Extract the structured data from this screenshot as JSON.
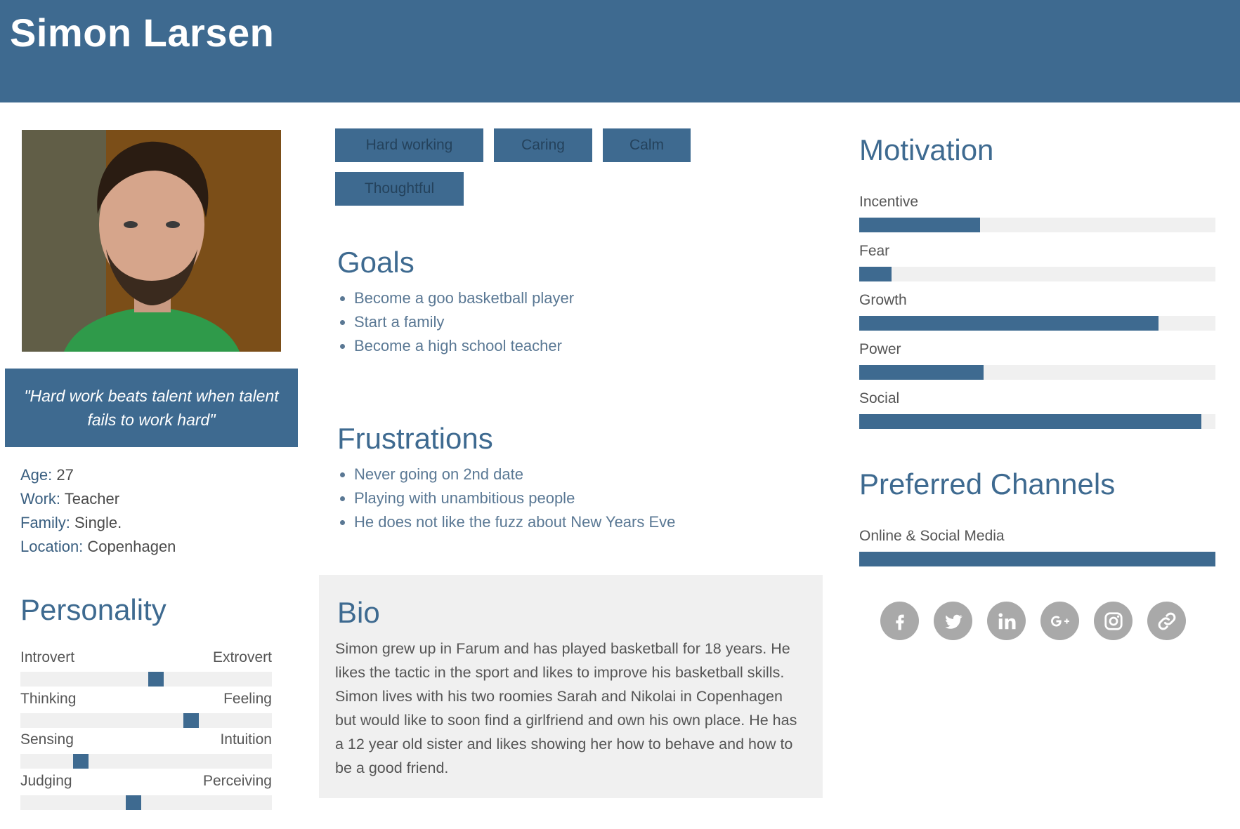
{
  "header": {
    "name": "Simon Larsen"
  },
  "quote": "\"Hard work beats talent when talent fails to work hard\"",
  "facts": [
    {
      "key": "Age:",
      "value": " 27"
    },
    {
      "key": "Work:",
      "value": " Teacher"
    },
    {
      "key": "Family:",
      "value": " Single."
    },
    {
      "key": "Location:",
      "value": " Copenhagen"
    }
  ],
  "personality": {
    "title": "Personality",
    "traits": [
      {
        "left": "Introvert",
        "right": "Extrovert",
        "value": 0.54
      },
      {
        "left": "Thinking",
        "right": "Feeling",
        "value": 0.68
      },
      {
        "left": "Sensing",
        "right": "Intuition",
        "value": 0.24
      },
      {
        "left": "Judging",
        "right": "Perceiving",
        "value": 0.45
      }
    ]
  },
  "tags": [
    "Hard working",
    "Caring",
    "Calm",
    "Thoughtful"
  ],
  "goals": {
    "title": "Goals",
    "items": [
      "Become a goo basketball player",
      "Start a family",
      "Become a high school teacher"
    ]
  },
  "frustrations": {
    "title": "Frustrations",
    "items": [
      "Never going on 2nd date",
      "Playing with unambitious people",
      "He does not like the fuzz about New Years Eve"
    ]
  },
  "bio": {
    "title": "Bio",
    "text": "Simon grew up in Farum and has played basketball for 18 years. He likes the tactic in the sport and likes to improve his basketball skills. Simon lives with his two roomies Sarah and Nikolai in Copenhagen but would like to soon find a girlfriend and own his own place. He has a 12 year old sister and likes showing her how to behave and how to be a good friend."
  },
  "motivation": {
    "title": "Motivation",
    "items": [
      {
        "label": "Incentive",
        "value": 0.34
      },
      {
        "label": "Fear",
        "value": 0.09
      },
      {
        "label": "Growth",
        "value": 0.84
      },
      {
        "label": "Power",
        "value": 0.35
      },
      {
        "label": "Social",
        "value": 0.96
      }
    ]
  },
  "channels": {
    "title": "Preferred Channels",
    "items": [
      {
        "label": "Online & Social Media",
        "value": 1.0
      }
    ],
    "icons": [
      "facebook-icon",
      "twitter-icon",
      "linkedin-icon",
      "google-plus-icon",
      "instagram-icon",
      "link-icon"
    ]
  },
  "colors": {
    "primary": "#3e6a90",
    "track": "#f0f0f0",
    "social": "#a9a9a9"
  }
}
